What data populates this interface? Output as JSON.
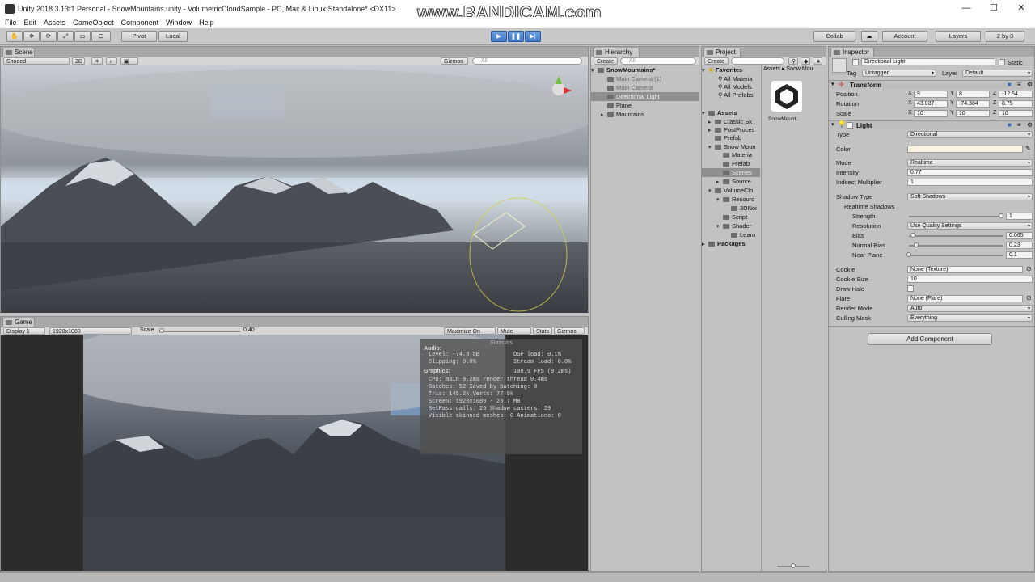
{
  "window": {
    "title": "Unity 2018.3.13f1 Personal - SnowMountains.unity - VolumetricCloudSample - PC, Mac & Linux Standalone* <DX11>",
    "watermark": "www.BANDICAM.com"
  },
  "menu": [
    "File",
    "Edit",
    "Assets",
    "GameObject",
    "Component",
    "Window",
    "Help"
  ],
  "toolbar": {
    "pivot": "Pivot",
    "local": "Local",
    "collab": "Collab",
    "account": "Account",
    "layers": "Layers",
    "layout": "2 by 3"
  },
  "scene": {
    "tab": "Scene",
    "shading": "Shaded",
    "mode_2d": "2D",
    "gizmos": "Gizmos",
    "search_placeholder": "All"
  },
  "game": {
    "tab": "Game",
    "display": "Display 1",
    "resolution": "1920x1080",
    "scale_label": "Scale",
    "scale_value": "0.40",
    "maximize": "Maximize On Play",
    "mute": "Mute Audio",
    "stats": "Stats",
    "gizmos": "Gizmos"
  },
  "statistics": {
    "title": "Statistics",
    "audio_header": "Audio:",
    "audio_rows": [
      [
        "Level: -74.8 dB",
        "DSP load: 0.1%"
      ],
      [
        "Clipping: 0.0%",
        "Stream load: 0.0%"
      ]
    ],
    "graphics_header": "Graphics:",
    "fps": "108.9 FPS (9.2ms)",
    "graphics_rows": [
      "CPU: main 9.2ms  render thread 0.4ms",
      "Batches: 52    Saved by batching: 0",
      "Tris: 145.2k    Verts: 77.9k",
      "Screen: 1920x1080 - 23.7 MB",
      "SetPass calls: 25   Shadow casters: 29",
      "Visible skinned meshes: 0  Animations: 0"
    ]
  },
  "hierarchy": {
    "tab": "Hierarchy",
    "create": "Create",
    "search_placeholder": "All",
    "scene_name": "SnowMountains*",
    "items": [
      "Main Camera (1)",
      "Main Camera",
      "Directional Light",
      "Plane",
      "Mountains"
    ]
  },
  "project": {
    "tab": "Project",
    "create": "Create",
    "favorites": "Favorites",
    "fav_items": [
      "All Materia",
      "All Models",
      "All Prefabs"
    ],
    "assets": "Assets",
    "asset_tree": [
      "Classic Sk",
      "PostProces",
      "Prefab",
      "Snow Moun",
      "Materia",
      "Prefab",
      "Scenes",
      "Source",
      "VolumeClo",
      "Resourc",
      "3DNoi",
      "Script",
      "Shader",
      "Learn"
    ],
    "packages": "Packages",
    "breadcrumb": [
      "Assets",
      "Snow Mou"
    ],
    "file_name": "SnowMount.."
  },
  "inspector": {
    "tab": "Inspector",
    "object_name": "Directional Light",
    "static": "Static",
    "tag_label": "Tag",
    "tag": "Untagged",
    "layer_label": "Layer",
    "layer": "Default",
    "transform": {
      "header": "Transform",
      "position_label": "Position",
      "position": [
        "9",
        "8",
        "-12.54"
      ],
      "rotation_label": "Rotation",
      "rotation": [
        "43.037",
        "-74.384",
        "8.75"
      ],
      "scale_label": "Scale",
      "scale": [
        "10",
        "10",
        "10"
      ]
    },
    "light": {
      "header": "Light",
      "type_label": "Type",
      "type": "Directional",
      "color_label": "Color",
      "color": "#fdf4e3",
      "mode_label": "Mode",
      "mode": "Realtime",
      "intensity_label": "Intensity",
      "intensity": "0.77",
      "indirect_label": "Indirect Multiplier",
      "indirect": "1",
      "shadow_type_label": "Shadow Type",
      "shadow_type": "Soft Shadows",
      "realtime_shadows": "Realtime Shadows",
      "strength_label": "Strength",
      "strength": "1",
      "resolution_label": "Resolution",
      "resolution": "Use Quality Settings",
      "bias_label": "Bias",
      "bias": "0.065",
      "normal_bias_label": "Normal Bias",
      "normal_bias": "0.23",
      "near_plane_label": "Near Plane",
      "near_plane": "0.1",
      "cookie_label": "Cookie",
      "cookie": "None (Texture)",
      "cookie_size_label": "Cookie Size",
      "cookie_size": "10",
      "draw_halo_label": "Draw Halo",
      "flare_label": "Flare",
      "flare": "None (Flare)",
      "render_mode_label": "Render Mode",
      "render_mode": "Auto",
      "culling_mask_label": "Culling Mask",
      "culling_mask": "Everything"
    },
    "add_component": "Add Component"
  }
}
